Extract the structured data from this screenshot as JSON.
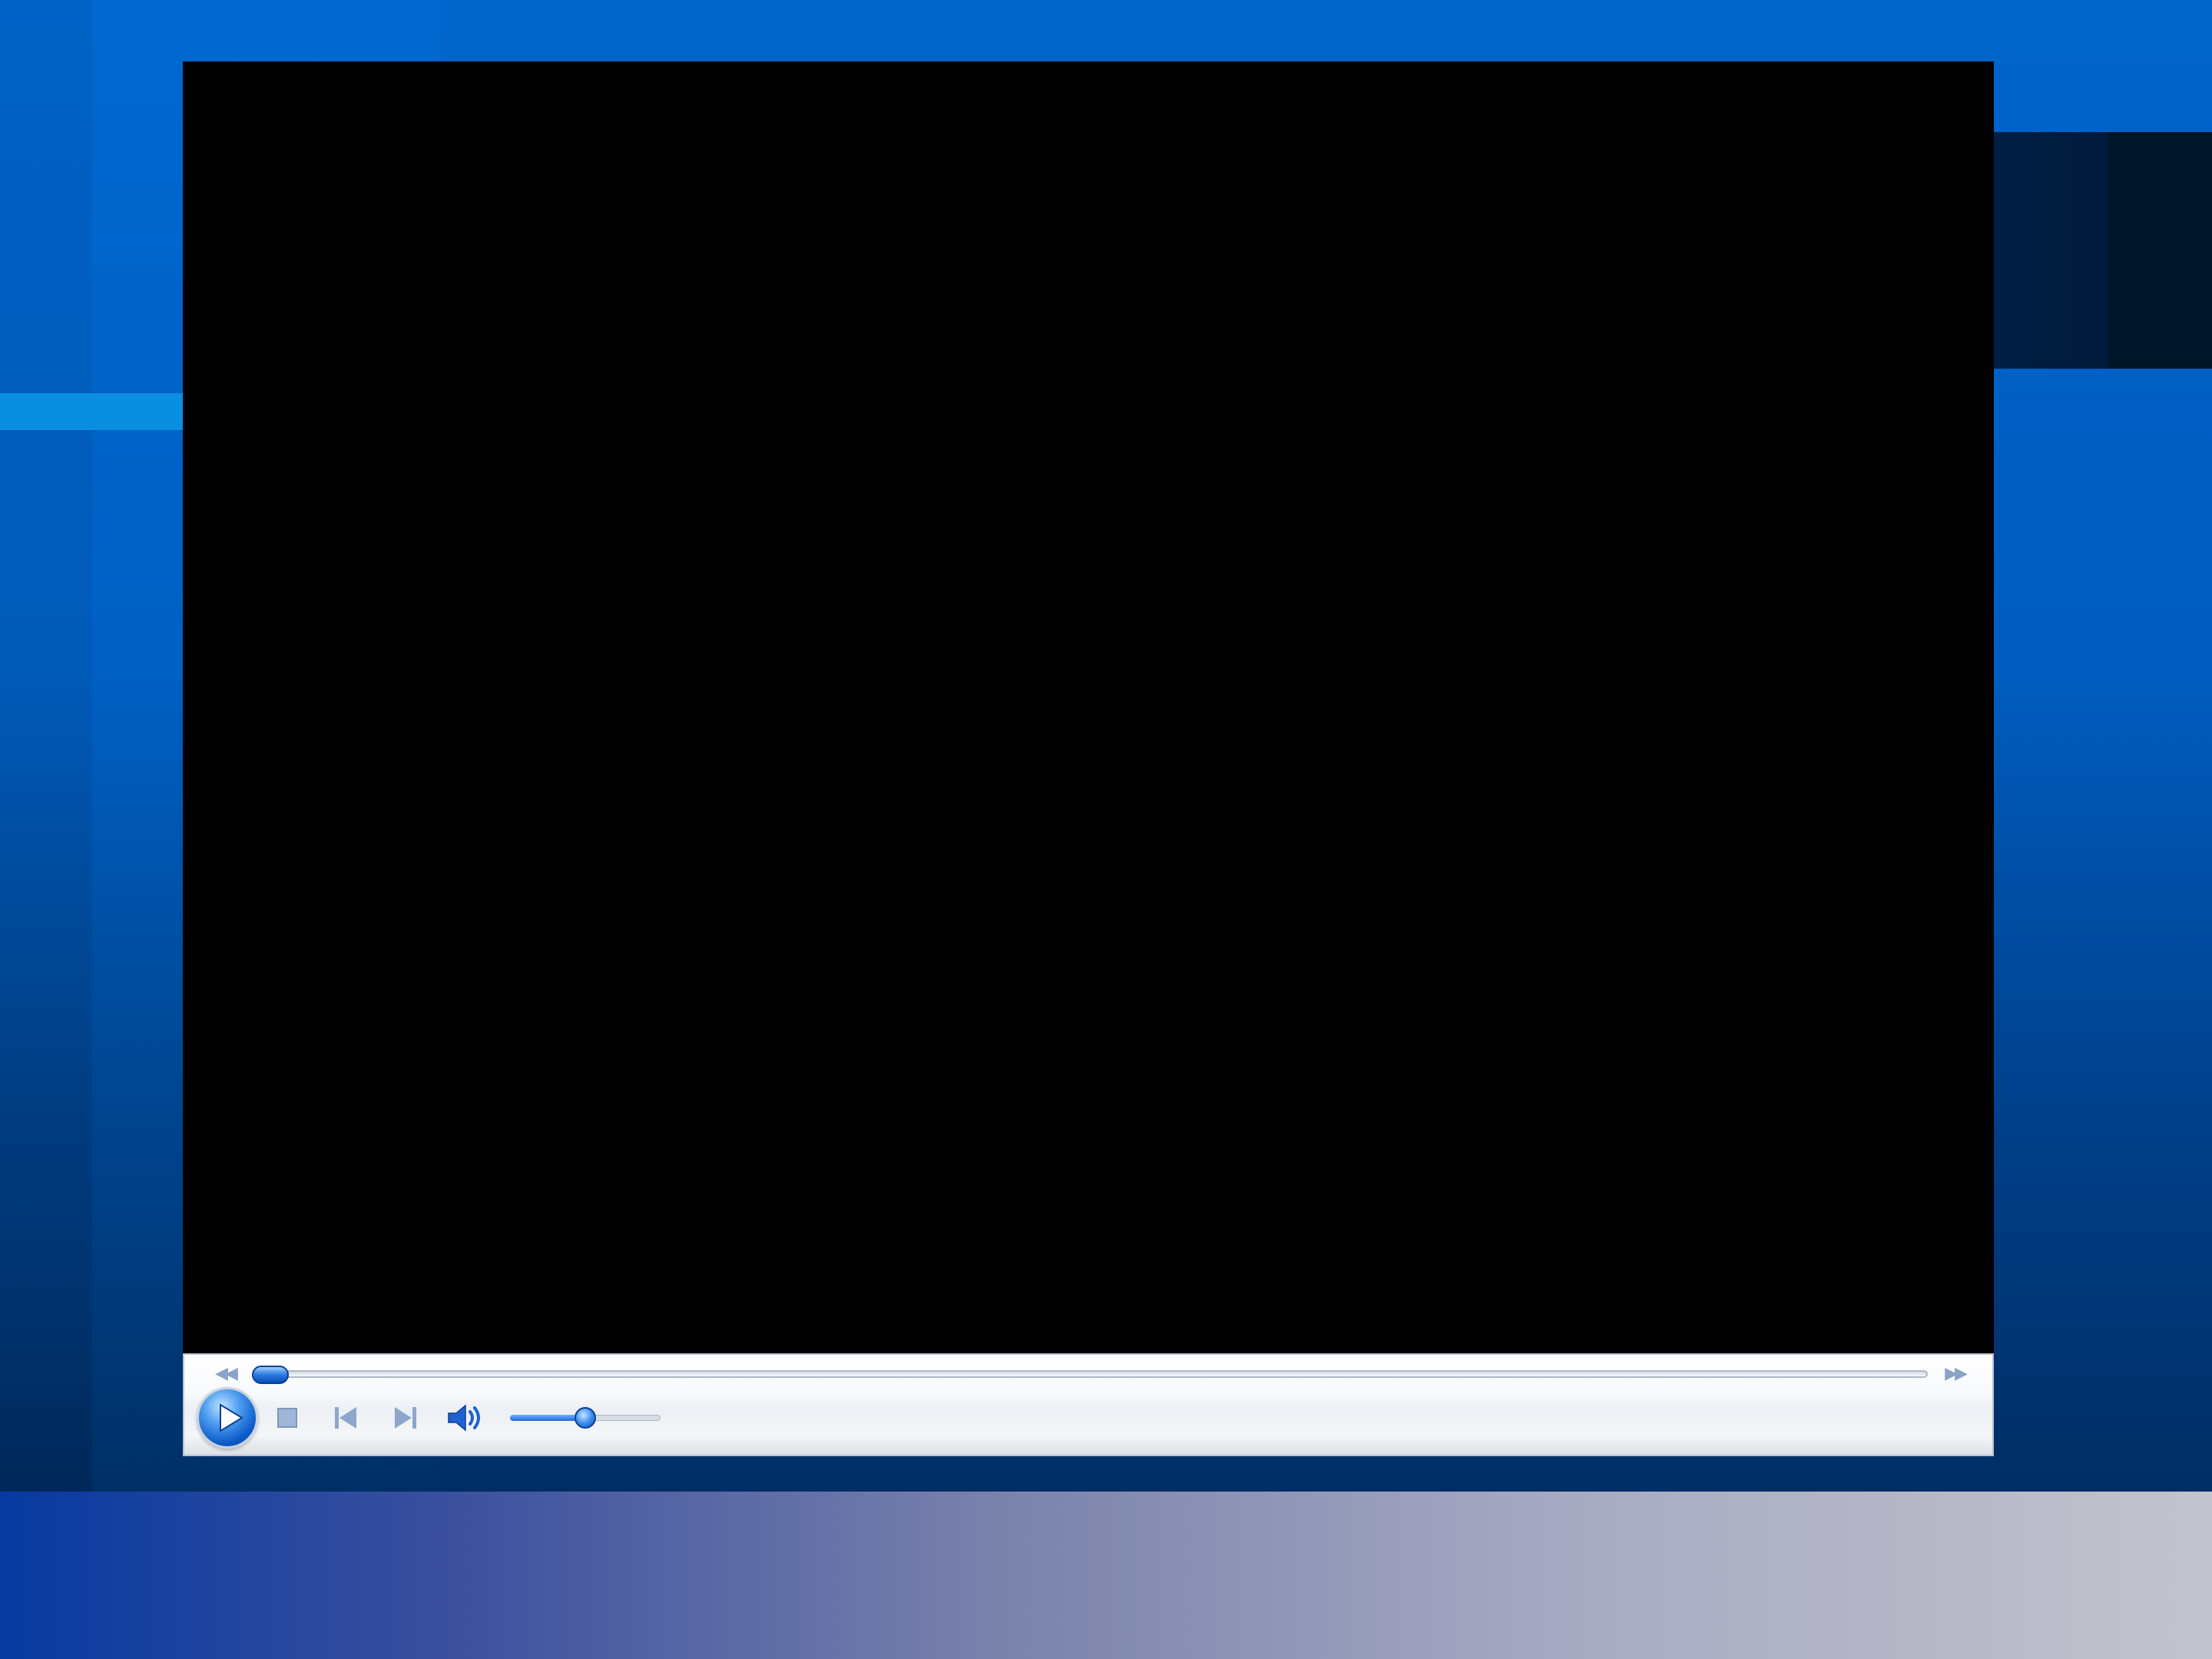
{
  "player": {
    "controls": {
      "seek_back_icon": "rewind-icon",
      "seek_forward_icon": "fast-forward-icon",
      "seek_position": 0.0,
      "play_icon": "play-icon",
      "stop_icon": "stop-icon",
      "previous_icon": "previous-track-icon",
      "next_icon": "next-track-icon",
      "mute_icon": "speaker-icon",
      "volume_level": 0.5
    }
  },
  "colors": {
    "accent": "#0d5bc9",
    "desktop_blue": "#0064cc",
    "video_background": "#000000"
  }
}
